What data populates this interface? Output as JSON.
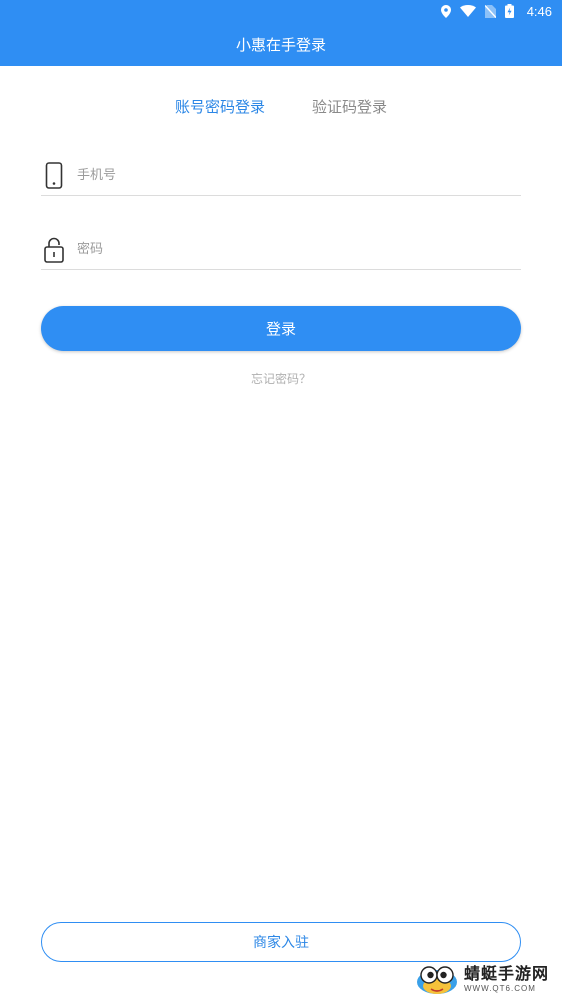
{
  "status_bar": {
    "time": "4:46",
    "icons": [
      "location-icon",
      "wifi-icon",
      "no-sim-icon",
      "battery-charging-icon"
    ]
  },
  "app_bar": {
    "title": "小惠在手登录"
  },
  "tabs": [
    {
      "label": "账号密码登录",
      "active": true
    },
    {
      "label": "验证码登录",
      "active": false
    }
  ],
  "form": {
    "phone": {
      "placeholder": "手机号",
      "value": "",
      "icon": "phone-icon"
    },
    "password": {
      "placeholder": "密码",
      "value": "",
      "icon": "lock-icon"
    },
    "login_label": "登录",
    "forgot_label": "忘记密码？"
  },
  "footer": {
    "merchant_label": "商家入驻"
  },
  "watermark": {
    "name": "蜻蜓手游网",
    "url": "WWW.QT6.COM"
  },
  "colors": {
    "primary": "#2f8ef3",
    "tab_active": "#2c87e6",
    "tab_inactive": "#8a8a8a",
    "placeholder": "#9b9b9b",
    "link_muted": "#b0b0b0"
  }
}
